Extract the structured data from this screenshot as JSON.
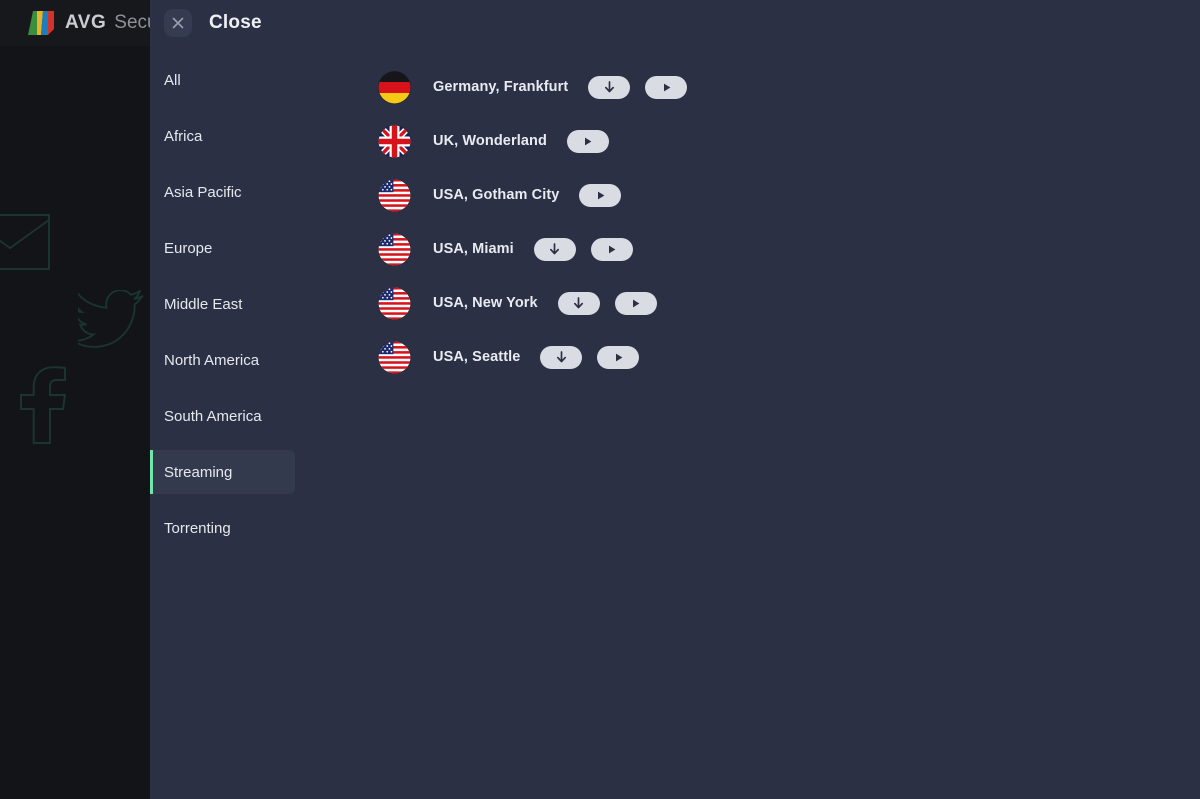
{
  "app": {
    "brand": "AVG",
    "product": "Secure VPN",
    "logo_icon": "avg-logo-icon",
    "background_color": "#121417",
    "social_icons": [
      {
        "name": "email-icon",
        "glyph": "envelope"
      },
      {
        "name": "twitter-icon",
        "glyph": "bird"
      },
      {
        "name": "facebook-icon",
        "glyph": "letter-f"
      }
    ]
  },
  "panel": {
    "background_color": "#2b3044",
    "accent_color": "#6ee7a8",
    "header": {
      "close_label": "Close",
      "close_icon": "close-x-icon"
    },
    "categories": [
      {
        "label": "All",
        "active": false
      },
      {
        "label": "Africa",
        "active": false
      },
      {
        "label": "Asia Pacific",
        "active": false
      },
      {
        "label": "Europe",
        "active": false
      },
      {
        "label": "Middle East",
        "active": false
      },
      {
        "label": "North America",
        "active": false
      },
      {
        "label": "South America",
        "active": false
      },
      {
        "label": "Streaming",
        "active": true
      },
      {
        "label": "Torrenting",
        "active": false
      }
    ],
    "servers": [
      {
        "name": "Germany, Frankfurt",
        "flag": "flag-de",
        "actions": [
          {
            "icon": "download-icon",
            "label": "Download"
          },
          {
            "icon": "play-icon",
            "label": "Connect"
          }
        ]
      },
      {
        "name": "UK, Wonderland",
        "flag": "flag-gb",
        "actions": [
          {
            "icon": "play-icon",
            "label": "Connect"
          }
        ]
      },
      {
        "name": "USA, Gotham City",
        "flag": "flag-us",
        "actions": [
          {
            "icon": "play-icon",
            "label": "Connect"
          }
        ]
      },
      {
        "name": "USA, Miami",
        "flag": "flag-us",
        "actions": [
          {
            "icon": "download-icon",
            "label": "Download"
          },
          {
            "icon": "play-icon",
            "label": "Connect"
          }
        ]
      },
      {
        "name": "USA, New York",
        "flag": "flag-us",
        "actions": [
          {
            "icon": "download-icon",
            "label": "Download"
          },
          {
            "icon": "play-icon",
            "label": "Connect"
          }
        ]
      },
      {
        "name": "USA, Seattle",
        "flag": "flag-us",
        "actions": [
          {
            "icon": "download-icon",
            "label": "Download"
          },
          {
            "icon": "play-icon",
            "label": "Connect"
          }
        ]
      }
    ]
  }
}
